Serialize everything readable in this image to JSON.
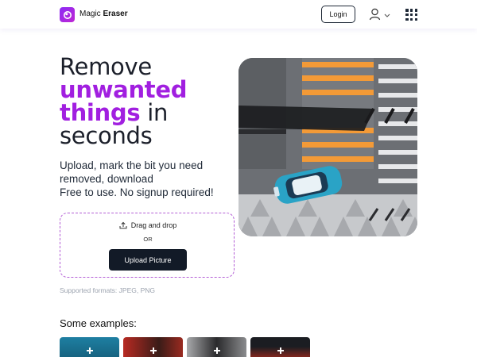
{
  "header": {
    "brand_prefix": "Magic",
    "brand_bold": "Eraser",
    "login_label": "Login",
    "logo_icon": "magic-eraser-logo-icon",
    "user_icon": "user-icon",
    "apps_icon": "apps-grid-icon"
  },
  "hero": {
    "title_line1": "Remove",
    "title_accent_line1": "unwanted",
    "title_accent_line2": "things",
    "title_in": " in",
    "title_line4": "seconds",
    "subtitle_line1": "Upload, mark the bit you need",
    "subtitle_line2": "removed, download",
    "subtitle_line3": "Free to use. No signup required!"
  },
  "upload": {
    "drag_label": "Drag and drop",
    "or_label": "OR",
    "button_label": "Upload Picture",
    "formats": "Supported formats: JPEG, PNG"
  },
  "examples": {
    "title": "Some examples:"
  },
  "colors": {
    "accent": "#a11fe0",
    "button_dark": "#121a27",
    "dashed_border": "#b45fd6"
  }
}
